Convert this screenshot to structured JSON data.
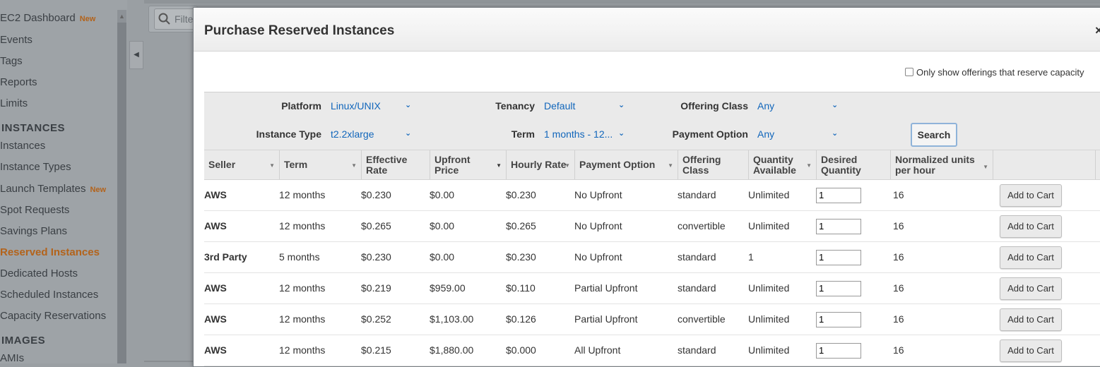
{
  "sidebar": {
    "items": [
      {
        "label": "EC2 Dashboard",
        "badge": "New"
      },
      {
        "label": "Events"
      },
      {
        "label": "Tags"
      },
      {
        "label": "Reports"
      },
      {
        "label": "Limits"
      },
      {
        "label": "INSTANCES",
        "section": true
      },
      {
        "label": "Instances"
      },
      {
        "label": "Instance Types"
      },
      {
        "label": "Launch Templates",
        "badge": "New"
      },
      {
        "label": "Spot Requests"
      },
      {
        "label": "Savings Plans"
      },
      {
        "label": "Reserved Instances",
        "active": true
      },
      {
        "label": "Dedicated Hosts"
      },
      {
        "label": "Scheduled Instances"
      },
      {
        "label": "Capacity Reservations"
      },
      {
        "label": "IMAGES",
        "section": true
      },
      {
        "label": "AMIs"
      }
    ]
  },
  "background": {
    "filter_placeholder": "Filte"
  },
  "modal": {
    "title": "Purchase Reserved Instances",
    "close": "×",
    "capacity_label": "Only show offerings that reserve capacity",
    "filters": {
      "platform": {
        "label": "Platform",
        "value": "Linux/UNIX"
      },
      "tenancy": {
        "label": "Tenancy",
        "value": "Default"
      },
      "offering_class": {
        "label": "Offering Class",
        "value": "Any"
      },
      "instance_type": {
        "label": "Instance Type",
        "value": "t2.2xlarge"
      },
      "term": {
        "label": "Term",
        "value": "1 months - 12..."
      },
      "payment_option": {
        "label": "Payment Option",
        "value": "Any"
      },
      "search_label": "Search"
    },
    "table": {
      "columns": [
        "Seller",
        "Term",
        "Effective Rate",
        "Upfront Price",
        "Hourly Rate",
        "Payment Option",
        "Offering Class",
        "Quantity Available",
        "Desired Quantity",
        "Normalized units per hour"
      ],
      "rows": [
        {
          "seller": "AWS",
          "term": "12 months",
          "effective": "$0.230",
          "upfront": "$0.00",
          "hourly": "$0.230",
          "payment": "No Upfront",
          "class": "standard",
          "available": "Unlimited",
          "desired": "1",
          "units": "16"
        },
        {
          "seller": "AWS",
          "term": "12 months",
          "effective": "$0.265",
          "upfront": "$0.00",
          "hourly": "$0.265",
          "payment": "No Upfront",
          "class": "convertible",
          "available": "Unlimited",
          "desired": "1",
          "units": "16"
        },
        {
          "seller": "3rd Party",
          "term": "5 months",
          "effective": "$0.230",
          "upfront": "$0.00",
          "hourly": "$0.230",
          "payment": "No Upfront",
          "class": "standard",
          "available": "1",
          "desired": "1",
          "units": "16"
        },
        {
          "seller": "AWS",
          "term": "12 months",
          "effective": "$0.219",
          "upfront": "$959.00",
          "hourly": "$0.110",
          "payment": "Partial Upfront",
          "class": "standard",
          "available": "Unlimited",
          "desired": "1",
          "units": "16"
        },
        {
          "seller": "AWS",
          "term": "12 months",
          "effective": "$0.252",
          "upfront": "$1,103.00",
          "hourly": "$0.126",
          "payment": "Partial Upfront",
          "class": "convertible",
          "available": "Unlimited",
          "desired": "1",
          "units": "16"
        },
        {
          "seller": "AWS",
          "term": "12 months",
          "effective": "$0.215",
          "upfront": "$1,880.00",
          "hourly": "$0.000",
          "payment": "All Upfront",
          "class": "standard",
          "available": "Unlimited",
          "desired": "1",
          "units": "16"
        }
      ],
      "add_to_cart_label": "Add to Cart"
    }
  },
  "colors": {
    "accent_link": "#1166bb",
    "active_nav": "#b3631b"
  }
}
